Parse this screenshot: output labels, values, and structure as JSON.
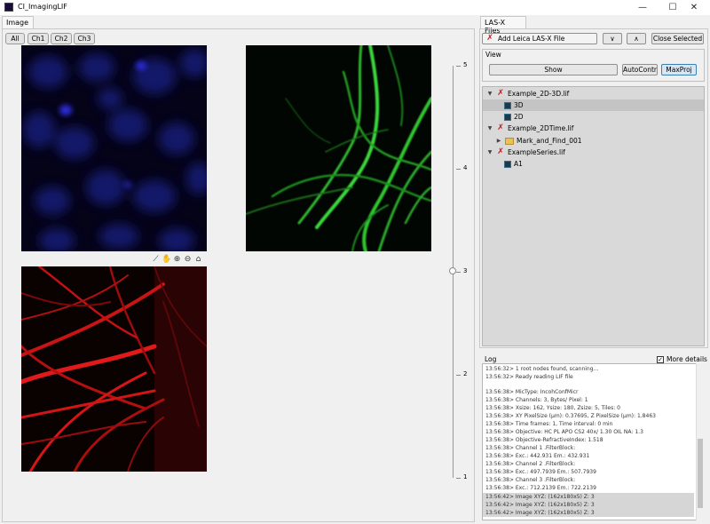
{
  "window": {
    "title": "CI_ImagingLIF",
    "min": "—",
    "max": "☐",
    "close": "✕"
  },
  "left": {
    "tab": "Image",
    "channels": [
      "All",
      "Ch1",
      "Ch2",
      "Ch3"
    ],
    "slider": {
      "ticks": [
        "5",
        "4",
        "3",
        "2",
        "1"
      ],
      "value": 3
    }
  },
  "right": {
    "tab": "LAS-X Files",
    "add_label": "Add Leica LAS-X File",
    "up_label": "∨",
    "down_label": "∧",
    "close_selected": "Close Selected",
    "view_label": "View",
    "show_label": "Show",
    "autocontr_label": "AutoContr",
    "maxproj_label": "MaxProj",
    "tree": [
      {
        "label": "Example_2D-3D.lif",
        "type": "file"
      },
      {
        "label": "3D",
        "type": "image",
        "selected": true
      },
      {
        "label": "2D",
        "type": "image"
      },
      {
        "label": "Example_2DTime.lif",
        "type": "file"
      },
      {
        "label": "Mark_and_Find_001",
        "type": "folder"
      },
      {
        "label": "ExampleSeries.lif",
        "type": "file"
      },
      {
        "label": "A1",
        "type": "image"
      }
    ]
  },
  "log": {
    "label": "Log",
    "more_details": "More details",
    "lines": [
      "13:56:32> 1 root nodes found, scanning...",
      "13:56:32> Ready reading LIF file",
      "",
      "13:56:38> MicType: IncohConfMicr",
      "13:56:38> Channels: 3, Bytes/ Pixel: 1",
      "13:56:38> Xsize: 162, Ysize: 180, Zsize: 5, Tiles: 0",
      "13:56:38> XY PixelSize (µm): 0.37695, Z PixelSize (µm): 1.8463",
      "13:56:38> Time frames: 1, Time interval: 0 min",
      "13:56:38> Objective: HC PL APO CS2   40x/ 1.30 OIL  NA: 1.3",
      "13:56:38> Objective-RefractiveIndex: 1.518",
      "13:56:38> Channel 1 .FilterBlock:",
      "13:56:38> Exc.: 442.931  Em.: 432.931",
      "13:56:38> Channel 2 .FilterBlock:",
      "13:56:38> Exc.: 497.7939  Em.: 507.7939",
      "13:56:38> Channel 3 .FilterBlock:",
      "13:56:38> Exc.: 712.2139  Em.: 722.2139",
      "13:56:42> Image XYZ: (162x180x5) Z: 3",
      "13:56:42> Image XYZ: (162x180x5) Z: 3",
      "13:56:42> Image XYZ: (162x180x5) Z: 3"
    ]
  },
  "colors": {
    "ch1": "#1616c8",
    "ch2": "#2ed62e",
    "ch3": "#e01010",
    "accent": "#3c7fb1"
  },
  "icons": [
    "pan-icon",
    "hand-icon",
    "zoom-in-icon",
    "zoom-out-icon",
    "home-icon"
  ]
}
